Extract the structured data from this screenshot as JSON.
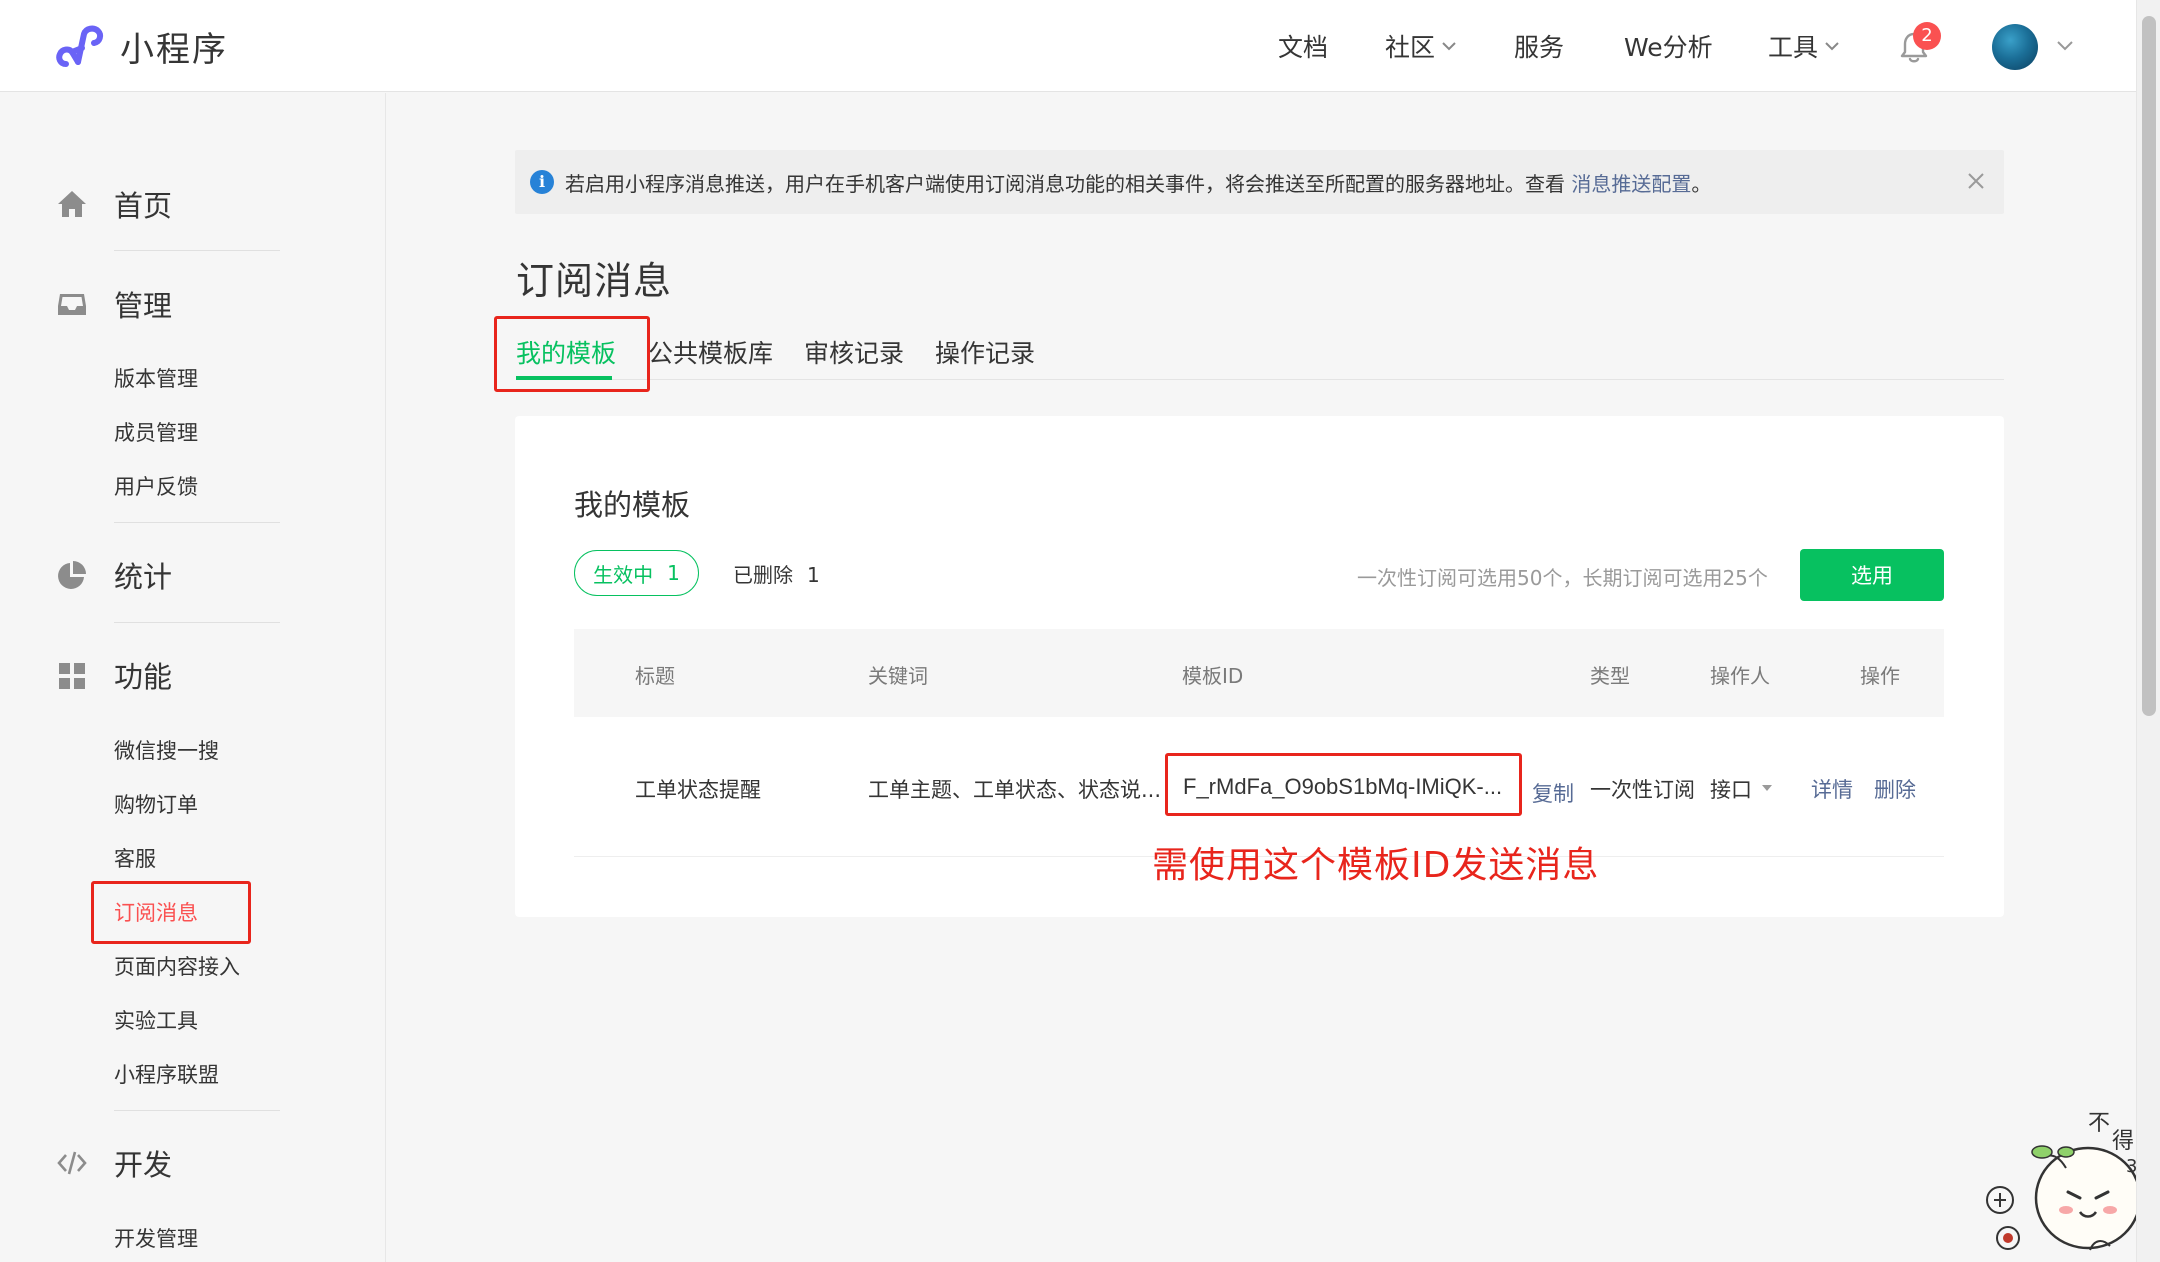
{
  "app": {
    "brand_title": "小程序"
  },
  "nav": {
    "items": [
      {
        "label": "文档",
        "has_dropdown": false
      },
      {
        "label": "社区",
        "has_dropdown": true
      },
      {
        "label": "服务",
        "has_dropdown": false
      },
      {
        "label": "We分析",
        "has_dropdown": false
      },
      {
        "label": "工具",
        "has_dropdown": true
      }
    ],
    "notification_count": "2"
  },
  "sidebar": {
    "groups": [
      {
        "label": "首页",
        "icon": "home-icon"
      },
      {
        "label": "管理",
        "icon": "inbox-icon",
        "items": [
          "版本管理",
          "成员管理",
          "用户反馈"
        ]
      },
      {
        "label": "统计",
        "icon": "pie-chart-icon"
      },
      {
        "label": "功能",
        "icon": "grid-icon",
        "items": [
          "微信搜一搜",
          "购物订单",
          "客服",
          "订阅消息",
          "页面内容接入",
          "实验工具",
          "小程序联盟"
        ]
      },
      {
        "label": "开发",
        "icon": "code-icon",
        "items": [
          "开发管理"
        ]
      }
    ],
    "active_item": "订阅消息"
  },
  "notice": {
    "text": "若启用小程序消息推送，用户在手机客户端使用订阅消息功能的相关事件，将会推送至所配置的服务器地址。查看 ",
    "link": "消息推送配置",
    "suffix": "。"
  },
  "page": {
    "title": "订阅消息",
    "tabs": [
      "我的模板",
      "公共模板库",
      "审核记录",
      "操作记录"
    ],
    "active_tab": "我的模板"
  },
  "card": {
    "title": "我的模板",
    "filter_active": {
      "label": "生效中",
      "count": "1"
    },
    "filter_deleted": {
      "label": "已删除",
      "count": "1"
    },
    "quota_text": "一次性订阅可选用50个，长期订阅可选用25个",
    "select_button": "选用",
    "columns": [
      "标题",
      "关键词",
      "模板ID",
      "类型",
      "操作人",
      "操作"
    ],
    "rows": [
      {
        "title": "工单状态提醒",
        "keywords": "工单主题、工单状态、状态说...",
        "template_id": "F_rMdFa_O9obS1bMq-IMiQK-...",
        "copy": "复制",
        "type": "一次性订阅",
        "operator": "接口",
        "detail": "详情",
        "delete": "删除"
      }
    ]
  },
  "annotation": {
    "text": "需使用这个模板ID发送消息",
    "color": "#e8251c"
  },
  "colors": {
    "accent": "#07c160",
    "link": "#576b95",
    "badge": "#fa5151"
  }
}
